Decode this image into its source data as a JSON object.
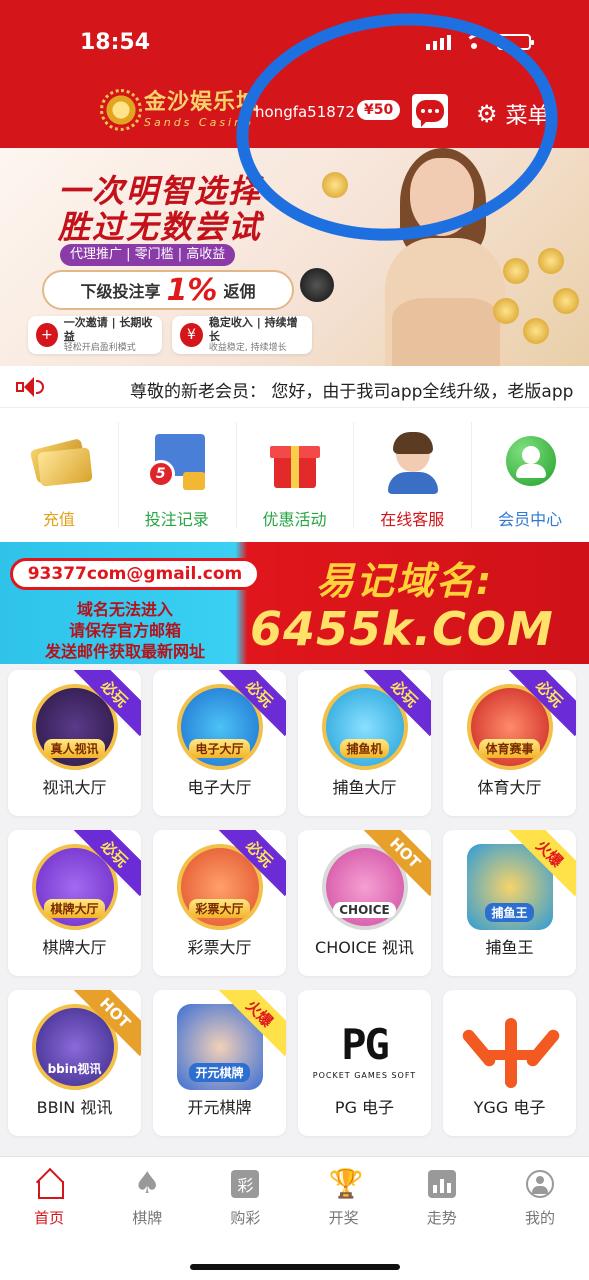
{
  "status_bar": {
    "time": "18:54"
  },
  "header": {
    "logo_cn": "金沙娱乐城",
    "logo_en": "Sands Casino",
    "username": "hongfa51872",
    "balance": "¥50",
    "menu_label": "菜单"
  },
  "banner": {
    "title_line1": "一次明智选择",
    "title_line2": "胜过无数尝试",
    "tags": "代理推广 | 零门槛 | 高收益",
    "pill_prefix": "下级投注享",
    "pill_percent": "1%",
    "pill_suffix": "返佣",
    "card1_main": "一次邀请 | 长期收益",
    "card1_sub": "轻松开启盈利模式",
    "card2_main": "稳定收入 | 持续增长",
    "card2_sub": "收益稳定, 持续增长"
  },
  "marquee": {
    "text": "尊敬的新老会员：  您好，由于我司app全线升级，老版app"
  },
  "quick_actions": [
    {
      "label": "充值",
      "color": "#e2a21a"
    },
    {
      "label": "投注记录",
      "color": "#27a545"
    },
    {
      "label": "优惠活动",
      "color": "#27a545"
    },
    {
      "label": "在线客服",
      "color": "#d4161b"
    },
    {
      "label": "会员中心",
      "color": "#2f78d6"
    }
  ],
  "notice": {
    "email": "93377com@gmail.com",
    "line1": "域名无法进入",
    "line2": "请保存官方邮箱",
    "line3": "发送邮件获取最新网址",
    "title": "易记域名:",
    "domain": "6455k.COM"
  },
  "games": [
    {
      "name": "视讯大厅",
      "art_label": "真人视讯",
      "ribbon": "必玩",
      "ribbon_style": "purple",
      "art_color": "#2a1742"
    },
    {
      "name": "电子大厅",
      "art_label": "电子大厅",
      "ribbon": "必玩",
      "ribbon_style": "purple",
      "art_color": "#1d6fd0"
    },
    {
      "name": "捕鱼大厅",
      "art_label": "捕鱼机",
      "ribbon": "必玩",
      "ribbon_style": "purple",
      "art_color": "#1fa0d8"
    },
    {
      "name": "体育大厅",
      "art_label": "体育赛事",
      "ribbon": "必玩",
      "ribbon_style": "purple",
      "art_color": "#c9221f"
    },
    {
      "name": "棋牌大厅",
      "art_label": "棋牌大厅",
      "ribbon": "必玩",
      "ribbon_style": "purple",
      "art_color": "#6a2bc6"
    },
    {
      "name": "彩票大厅",
      "art_label": "彩票大厅",
      "ribbon": "必玩",
      "ribbon_style": "purple",
      "art_color": "#e0502a"
    },
    {
      "name": "CHOICE 视讯",
      "art_label": "CHOICE",
      "ribbon": "HOT",
      "ribbon_style": "gold",
      "art_color": "#d04aa0"
    },
    {
      "name": "捕鱼王",
      "art_label": "捕鱼王",
      "ribbon": "火爆",
      "ribbon_style": "yellow",
      "art_color": "#2d9bd8"
    },
    {
      "name": "BBIN 视讯",
      "art_label": "bbin视讯",
      "ribbon": "HOT",
      "ribbon_style": "gold",
      "art_color": "#3b2a8a"
    },
    {
      "name": "开元棋牌",
      "art_label": "开元棋牌",
      "ribbon": "火爆",
      "ribbon_style": "yellow",
      "art_color": "#3b6fd6"
    },
    {
      "name": "PG 电子",
      "logo": "PG",
      "logo_sub": "POCKET GAMES SOFT"
    },
    {
      "name": "YGG 电子",
      "logo": "ygg"
    }
  ],
  "tabs": [
    {
      "label": "首页",
      "icon": "home-icon",
      "active": true
    },
    {
      "label": "棋牌",
      "icon": "spade-icon",
      "glyph": "♠"
    },
    {
      "label": "购彩",
      "icon": "lottery-icon",
      "glyph": "彩"
    },
    {
      "label": "开奖",
      "icon": "trophy-icon",
      "glyph": "🏆"
    },
    {
      "label": "走势",
      "icon": "trend-icon"
    },
    {
      "label": "我的",
      "icon": "user-icon"
    }
  ],
  "colors": {
    "brand_red": "#d4161b",
    "annotation_blue": "#1e6fe0"
  }
}
